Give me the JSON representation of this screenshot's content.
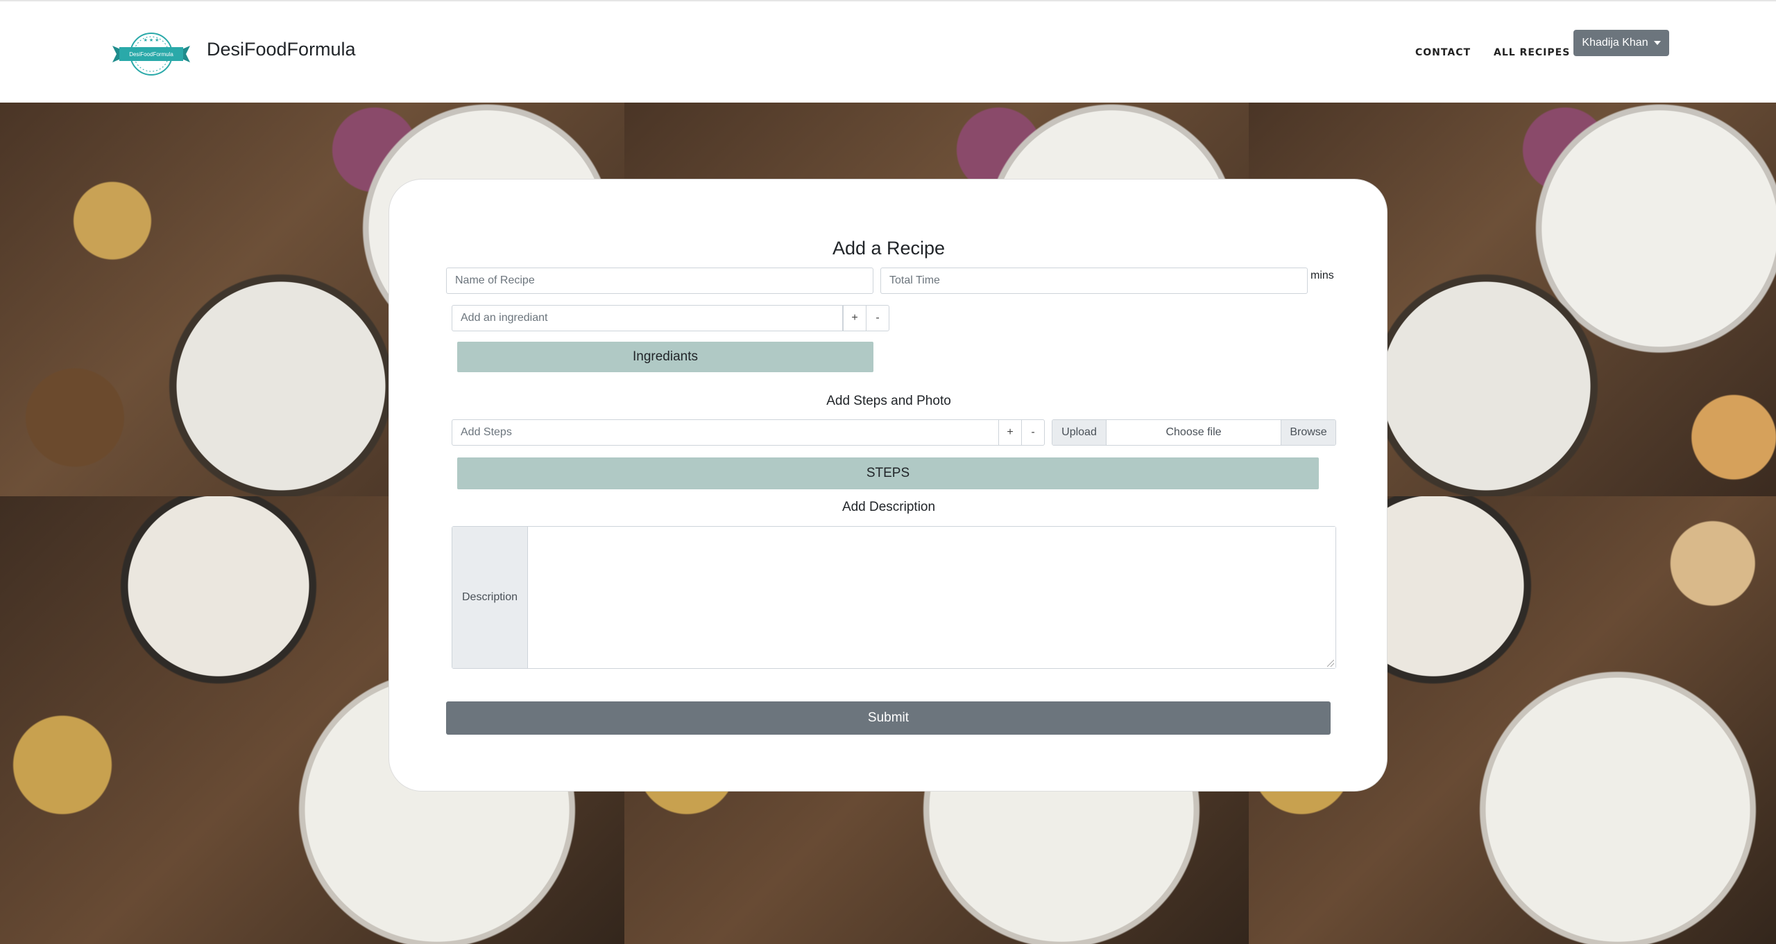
{
  "navbar": {
    "logo_text": "DesiFoodFormula",
    "brand": "DesiFoodFormula",
    "links": [
      "CONTACT",
      "ALL RECIPES"
    ],
    "user": "Khadija Khan"
  },
  "form": {
    "title": "Add a Recipe",
    "name_placeholder": "Name of Recipe",
    "time_placeholder": "Total Time",
    "time_unit": "mins",
    "ingredient_placeholder": "Add an ingrediant",
    "plus": "+",
    "minus": "-",
    "ingredients_bar": "Ingrediants",
    "steps_heading": "Add Steps and Photo",
    "steps_placeholder": "Add Steps",
    "upload_label": "Upload",
    "choose_file": "Choose file",
    "browse": "Browse",
    "steps_bar": "STEPS",
    "description_heading": "Add Description",
    "description_label": "Description",
    "description_value": "",
    "submit": "Submit"
  },
  "colors": {
    "accent_bar": "#b0c9c5",
    "button_gray": "#6c757d",
    "logo_teal": "#2aa9a9"
  }
}
